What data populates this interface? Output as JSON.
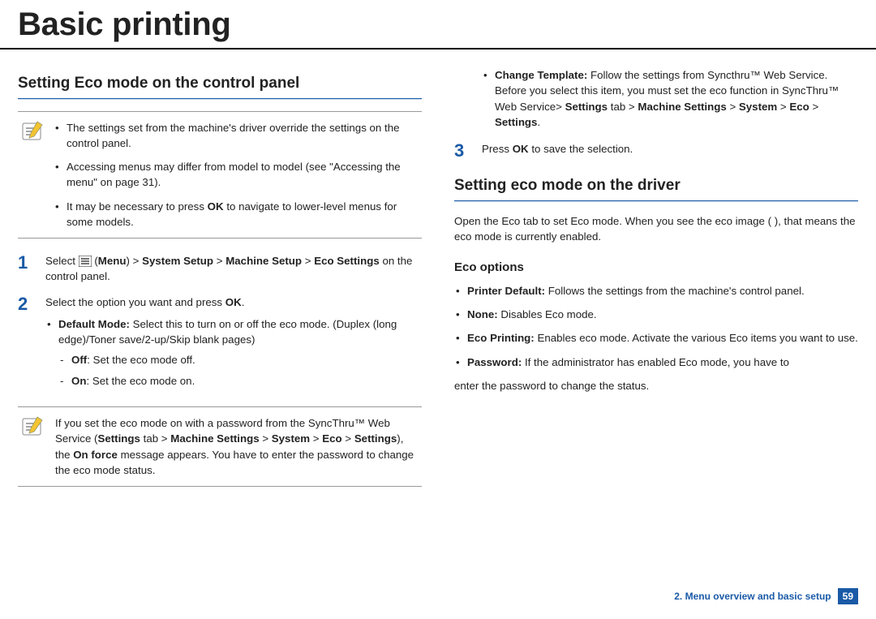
{
  "title": "Basic printing",
  "left": {
    "section_heading": "Setting Eco mode on the control panel",
    "note1": {
      "items": [
        "The settings set from the machine's driver override the settings on the control panel.",
        "Accessing menus may differ from model to model (see \"Accessing the menu\" on page 31).",
        "It may be necessary to press OK to navigate to lower-level menus for some models."
      ],
      "bold_in_3": "OK"
    },
    "step1": {
      "num": "1",
      "pre": "Select ",
      "menu_label": "Menu",
      "path_parts": [
        "System Setup",
        "Machine Setup",
        "Eco Settings"
      ],
      "post": " on the control panel."
    },
    "step2": {
      "num": "2",
      "lead_pre": "Select the option you want and press ",
      "lead_bold": "OK",
      "lead_post": ".",
      "default_mode_label": "Default Mode:",
      "default_mode_text": " Select this to turn on or off the eco mode. (Duplex (long edge)/Toner save/2-up/Skip blank pages)",
      "off_label": "Off",
      "off_text": ": Set the eco mode off.",
      "on_label": "On",
      "on_text": ": Set the eco mode on."
    },
    "note2": {
      "pre": "If you set the eco mode on with a password from the SyncThru™ Web Service (",
      "settings_label": "Settings",
      "path_parts": [
        "Machine Settings",
        "System",
        "Eco",
        "Settings"
      ],
      "mid": "), the ",
      "onforce": "On force",
      "post": " message appears. You have to enter the password to change the eco mode status."
    }
  },
  "right": {
    "change_template": {
      "label": "Change Template:",
      "text1": " Follow the settings from Syncthru™ Web Service. Before you select this item, you must set the eco function in SyncThru™ Web Service> ",
      "settings_label": "Settings",
      "tab_word": " tab > ",
      "path_parts": [
        "Machine Settings",
        "System",
        "Eco",
        "Settings"
      ],
      "period": "."
    },
    "step3": {
      "num": "3",
      "pre": "Press ",
      "ok": "OK",
      "post": " to save the selection."
    },
    "section_heading": "Setting eco mode on the driver",
    "intro": "Open the Eco tab to set Eco mode. When you see the eco image (        ), that means the eco mode is currently enabled.",
    "sub_heading": "Eco options",
    "opts": {
      "printer_default_label": "Printer Default:",
      "printer_default_text": " Follows the settings from the machine's control panel.",
      "none_label": "None:",
      "none_text": " Disables Eco mode.",
      "eco_printing_label": "Eco Printing:",
      "eco_printing_text": " Enables eco mode. Activate the various Eco items you want to use.",
      "password_label": "Password:",
      "password_text": " If the administrator has enabled Eco mode, you have to"
    },
    "trailing": "enter the password to change the status."
  },
  "footer": {
    "chapter": "2.  Menu overview and basic setup",
    "page": "59"
  }
}
